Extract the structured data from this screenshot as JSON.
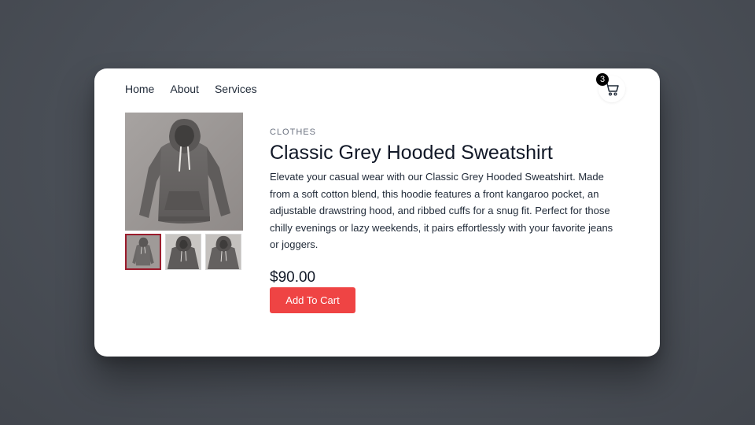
{
  "nav": {
    "items": [
      {
        "label": "Home"
      },
      {
        "label": "About"
      },
      {
        "label": "Services"
      }
    ]
  },
  "cart": {
    "count": "3",
    "icon": "cart-icon"
  },
  "product": {
    "category": "CLOTHES",
    "title": "Classic Grey Hooded Sweatshirt",
    "description": "Elevate your casual wear with our Classic Grey Hooded Sweatshirt. Made from a soft cotton blend, this hoodie features a front kangaroo pocket, an adjustable drawstring hood, and ribbed cuffs for a snug fit. Perfect for those chilly evenings or lazy weekends, it pairs effortlessly with your favorite jeans or joggers.",
    "price": "$90.00",
    "add_to_cart_label": "Add To Cart",
    "selected_thumbnail": 1,
    "thumbnails_count": 3
  },
  "colors": {
    "accent": "#ef4444",
    "thumbnail_selected_border": "#9b1c2c",
    "badge": "#000000",
    "page_background": "#4b5058"
  }
}
